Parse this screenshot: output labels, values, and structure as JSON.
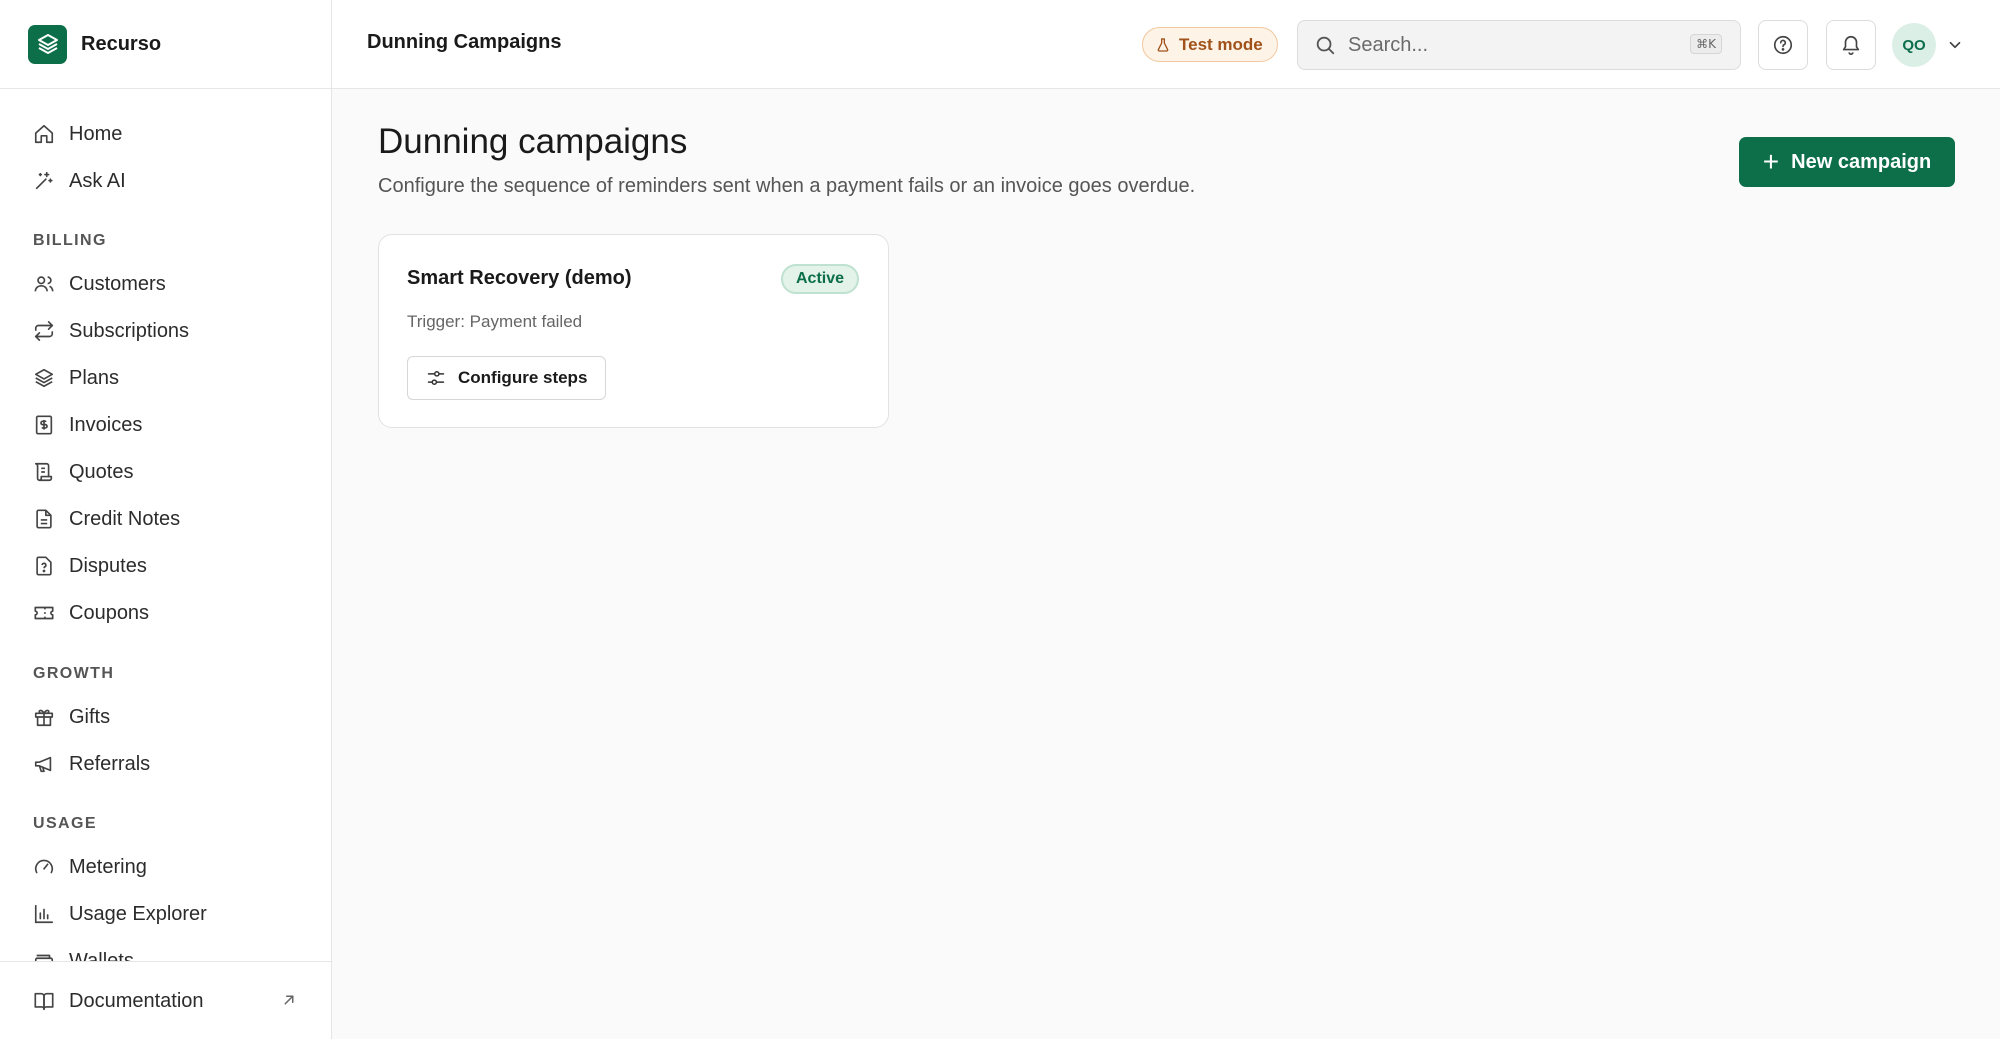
{
  "brand": {
    "name": "Recurso"
  },
  "sidebar": {
    "top_items": [
      {
        "label": "Home",
        "icon": "home-icon"
      },
      {
        "label": "Ask AI",
        "icon": "sparkles-icon"
      }
    ],
    "sections": [
      {
        "title": "BILLING",
        "items": [
          {
            "label": "Customers",
            "icon": "users-icon"
          },
          {
            "label": "Subscriptions",
            "icon": "repeat-icon"
          },
          {
            "label": "Plans",
            "icon": "layers-icon"
          },
          {
            "label": "Invoices",
            "icon": "invoice-dollar-icon"
          },
          {
            "label": "Quotes",
            "icon": "scroll-icon"
          },
          {
            "label": "Credit Notes",
            "icon": "file-icon"
          },
          {
            "label": "Disputes",
            "icon": "file-question-icon"
          },
          {
            "label": "Coupons",
            "icon": "ticket-icon"
          }
        ]
      },
      {
        "title": "GROWTH",
        "items": [
          {
            "label": "Gifts",
            "icon": "gift-icon"
          },
          {
            "label": "Referrals",
            "icon": "megaphone-icon"
          }
        ]
      },
      {
        "title": "USAGE",
        "items": [
          {
            "label": "Metering",
            "icon": "gauge-icon"
          },
          {
            "label": "Usage Explorer",
            "icon": "bar-chart-icon"
          },
          {
            "label": "Wallets",
            "icon": "wallet-icon"
          }
        ]
      }
    ],
    "footer": {
      "label": "Documentation",
      "icon": "book-icon"
    }
  },
  "header": {
    "title": "Dunning Campaigns",
    "test_mode": "Test mode",
    "search_placeholder": "Search...",
    "search_shortcut": "⌘K",
    "avatar_initials": "QO"
  },
  "main": {
    "title": "Dunning campaigns",
    "subtitle": "Configure the sequence of reminders sent when a payment fails or an invoice goes overdue.",
    "new_button": "New campaign",
    "campaigns": [
      {
        "name": "Smart Recovery (demo)",
        "status": "Active",
        "trigger": "Trigger: Payment failed",
        "action": "Configure steps"
      }
    ]
  },
  "colors": {
    "accent": "#0d6e4a",
    "test_mode_text": "#a0521a",
    "test_mode_bg": "#fdf3e7",
    "active_badge_bg": "#e3f3ea"
  }
}
